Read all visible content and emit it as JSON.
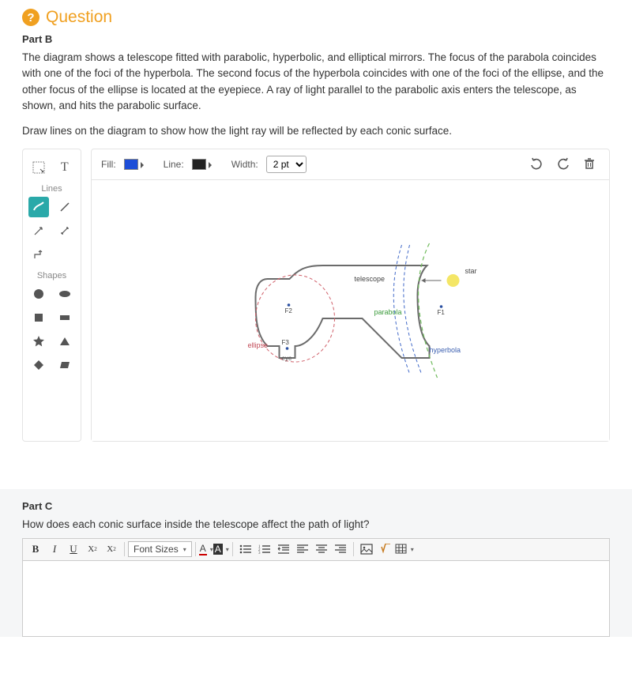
{
  "header": {
    "icon_text": "?",
    "title": "Question"
  },
  "partB": {
    "label": "Part B",
    "paragraph1": "The diagram shows a telescope fitted with parabolic, hyperbolic, and elliptical mirrors. The focus of the parabola coincides with one of the foci of the hyperbola. The second focus of the hyperbola coincides with one of the foci of the ellipse, and the other focus of the ellipse is located at the eyepiece. A ray of light parallel to the parabolic axis enters the telescope, as shown, and hits the parabolic surface.",
    "paragraph2": "Draw lines on the diagram to show how the light ray will be reflected by each conic surface."
  },
  "palette": {
    "lines_label": "Lines",
    "shapes_label": "Shapes"
  },
  "canvasToolbar": {
    "fill_label": "Fill:",
    "line_label": "Line:",
    "width_label": "Width:",
    "width_value": "2 pt"
  },
  "diagram": {
    "star": "star",
    "telescope": "telescope",
    "parabola": "parabola",
    "hyperbola": "hyperbola",
    "ellipse": "ellipse",
    "eye": "eye",
    "F1": "F1",
    "F2": "F2",
    "F3": "F3"
  },
  "partC": {
    "label": "Part C",
    "question": "How does each conic surface inside the telescope affect the path of light?"
  },
  "editor": {
    "font_sizes": "Font Sizes"
  }
}
